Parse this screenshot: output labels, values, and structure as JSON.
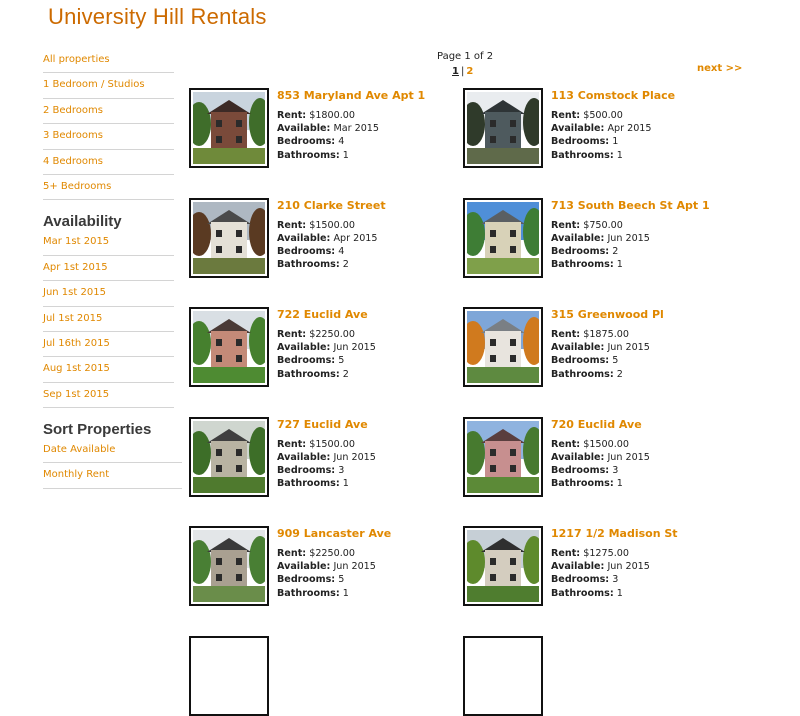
{
  "site": {
    "title": "University Hill Rentals"
  },
  "sidebar": {
    "property_links": [
      "All properties",
      "1 Bedroom / Studios",
      "2 Bedrooms",
      "3 Bedrooms",
      "4 Bedrooms",
      "5+ Bedrooms"
    ],
    "availability": {
      "heading": "Availability",
      "links": [
        "Mar 1st 2015",
        "Apr 1st 2015",
        "Jun 1st 2015",
        "Jul 1st 2015",
        "Jul 16th 2015",
        "Aug 1st 2015",
        "Sep 1st 2015"
      ]
    },
    "sort": {
      "heading": "Sort Properties",
      "links": [
        "Date Available",
        "Monthly Rent"
      ]
    }
  },
  "pager": {
    "info": "Page 1 of 2",
    "current": "1",
    "separator": "|",
    "other": "2",
    "next": "next >>"
  },
  "labels": {
    "rent": "Rent:",
    "available": "Available:",
    "bedrooms": "Bedrooms:",
    "bathrooms": "Bathrooms:"
  },
  "listings": [
    {
      "title": "853 Maryland Ave Apt 1",
      "rent": "$1800.00",
      "available": "Mar 2015",
      "bedrooms": "4",
      "bathrooms": "1"
    },
    {
      "title": "113 Comstock Place",
      "rent": "$500.00",
      "available": "Apr 2015",
      "bedrooms": "1",
      "bathrooms": "1"
    },
    {
      "title": "210 Clarke Street",
      "rent": "$1500.00",
      "available": "Apr 2015",
      "bedrooms": "4",
      "bathrooms": "2"
    },
    {
      "title": "713 South Beech St Apt 1",
      "rent": "$750.00",
      "available": "Jun 2015",
      "bedrooms": "2",
      "bathrooms": "1"
    },
    {
      "title": "722 Euclid Ave",
      "rent": "$2250.00",
      "available": "Jun 2015",
      "bedrooms": "5",
      "bathrooms": "2"
    },
    {
      "title": "315 Greenwood Pl",
      "rent": "$1875.00",
      "available": "Jun 2015",
      "bedrooms": "5",
      "bathrooms": "2"
    },
    {
      "title": "727 Euclid Ave",
      "rent": "$1500.00",
      "available": "Jun 2015",
      "bedrooms": "3",
      "bathrooms": "1"
    },
    {
      "title": "720 Euclid Ave",
      "rent": "$1500.00",
      "available": "Jun 2015",
      "bedrooms": "3",
      "bathrooms": "1"
    },
    {
      "title": "909 Lancaster Ave",
      "rent": "$2250.00",
      "available": "Jun 2015",
      "bedrooms": "5",
      "bathrooms": "1"
    },
    {
      "title": "1217 1/2 Madison St",
      "rent": "$1275.00",
      "available": "Jun 2015",
      "bedrooms": "3",
      "bathrooms": "1"
    }
  ],
  "colors": {
    "brand": "#cc6a00",
    "link": "#e08800",
    "heading": "#3a3a3a",
    "divider": "#d4d4d4"
  }
}
